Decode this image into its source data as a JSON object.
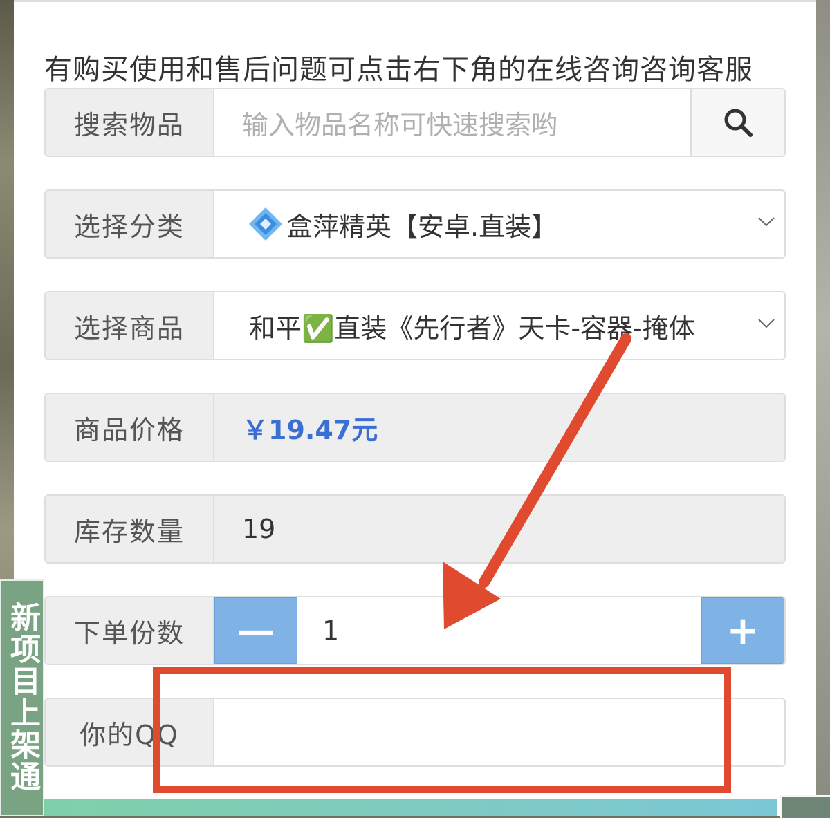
{
  "notice": "有购买使用和售后问题可点击右下角的在线咨询咨询客服",
  "search": {
    "label": "搜索物品",
    "placeholder": "输入物品名称可快速搜索哟",
    "icon": "search-icon"
  },
  "category": {
    "label": "选择分类",
    "selected": "盒萍精英【安卓.直装】",
    "icon": "diamond-icon",
    "chevron": "chevron-down-icon"
  },
  "product": {
    "label": "选择商品",
    "selected": "和平✅直装《先行者》天卡-容器-掩体",
    "chevron": "chevron-down-icon"
  },
  "price": {
    "label": "商品价格",
    "value": "￥19.47元",
    "color": "#3b6fd3"
  },
  "stock": {
    "label": "库存数量",
    "value": "19"
  },
  "quantity": {
    "label": "下单份数",
    "minus": "—",
    "value": "1",
    "plus": "+",
    "button_color": "#7fb3e6"
  },
  "qq": {
    "label": "你的QQ",
    "value": ""
  },
  "side_tag": {
    "text": "新项目上架通"
  },
  "annotation": {
    "color": "#e04a2f",
    "shapes": [
      "arrow",
      "highlight-box"
    ]
  }
}
